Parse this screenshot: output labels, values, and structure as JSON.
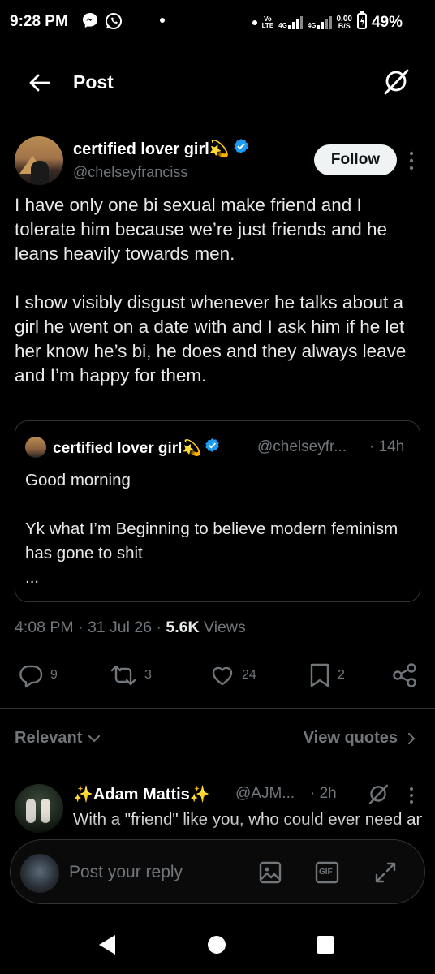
{
  "status_bar": {
    "time": "9:28 PM",
    "network_line1": "Vo",
    "network_line2": "LTE",
    "net_type_1": "4G",
    "net_type_2": "4G",
    "speed_top": "0.00",
    "speed_bottom": "B/S",
    "battery": "49%"
  },
  "header": {
    "title": "Post"
  },
  "post": {
    "author_name": "certified lover girl💫",
    "author_handle": "@chelseyfranciss",
    "follow_label": "Follow",
    "text": "I have only one bi sexual make friend and I tolerate him because we’re just friends and he leans heavily towards men.\n\nI show visibly disgust whenever he talks about a girl he went on a date with and I ask him if he let her know he’s bi, he does and they always leave and I’m happy for them.",
    "quote": {
      "author_name": "certified lover girl💫",
      "author_handle": "@chelseyfr...",
      "time": "· 14h",
      "text": "Good morning\n\nYk what I’m Beginning to believe modern feminism has gone to shit\n..."
    },
    "meta_time": "4:08 PM · 31 Jul 26 · ",
    "views_count": "5.6K",
    "views_label": " Views",
    "actions": {
      "replies": "9",
      "reposts": "3",
      "likes": "24",
      "bookmarks": "2"
    }
  },
  "sort": {
    "relevant_label": "Relevant",
    "view_quotes_label": "View quotes"
  },
  "reply": {
    "author_name": "✨Adam Mattis✨",
    "author_handle": "@AJM...",
    "time": "· 2h",
    "text": "With a \"friend\" like you, who could ever need an enemy?"
  },
  "composer": {
    "placeholder": "Post your reply",
    "gif_label": "GIF"
  },
  "colors": {
    "background": "#000000",
    "text": "#e7e9ea",
    "muted": "#71767b",
    "border": "#2f3336",
    "verified": "#1d9bf0"
  }
}
